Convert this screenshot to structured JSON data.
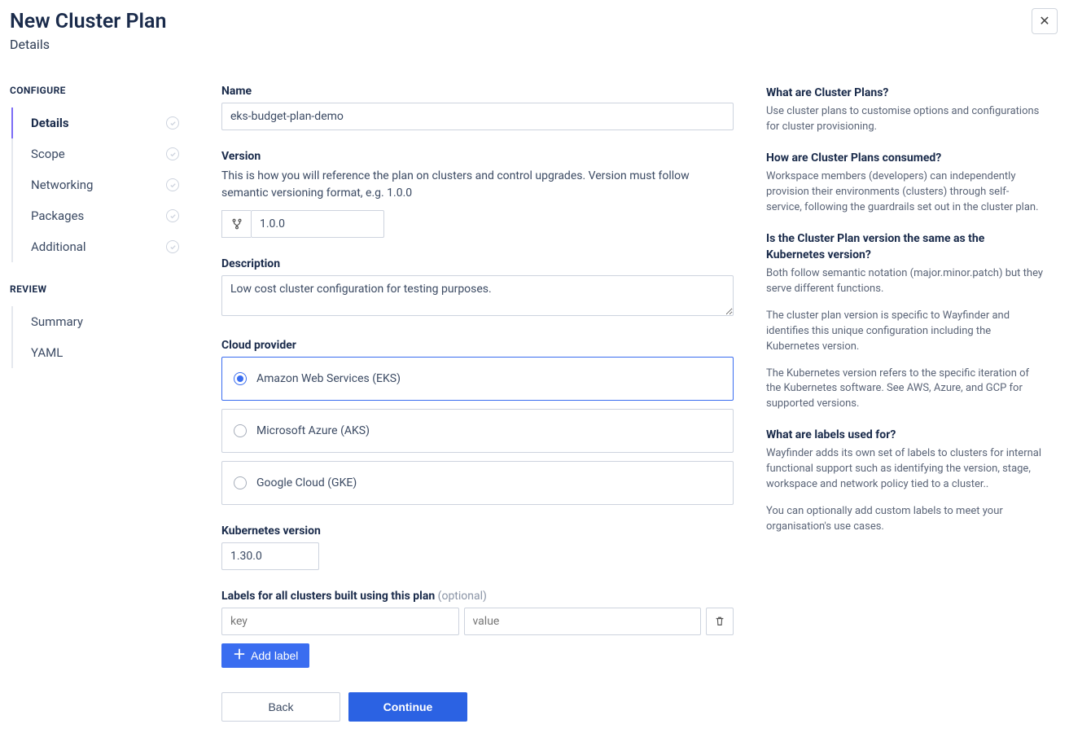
{
  "header": {
    "title": "New Cluster Plan",
    "subtitle": "Details"
  },
  "sidebar": {
    "configure_label": "CONFIGURE",
    "review_label": "REVIEW",
    "configure_items": [
      {
        "label": "Details"
      },
      {
        "label": "Scope"
      },
      {
        "label": "Networking"
      },
      {
        "label": "Packages"
      },
      {
        "label": "Additional"
      }
    ],
    "review_items": [
      {
        "label": "Summary"
      },
      {
        "label": "YAML"
      }
    ]
  },
  "form": {
    "name_label": "Name",
    "name_value": "eks-budget-plan-demo",
    "version_label": "Version",
    "version_hint": "This is how you will reference the plan on clusters and control upgrades. Version must follow semantic versioning format, e.g. 1.0.0",
    "version_value": "1.0.0",
    "description_label": "Description",
    "description_value": "Low cost cluster configuration for testing purposes.",
    "cloud_label": "Cloud provider",
    "cloud_options": [
      {
        "label": "Amazon Web Services (EKS)",
        "selected": true
      },
      {
        "label": "Microsoft Azure (AKS)",
        "selected": false
      },
      {
        "label": "Google Cloud (GKE)",
        "selected": false
      }
    ],
    "k8s_label": "Kubernetes version",
    "k8s_value": "1.30.0",
    "labels_label": "Labels for all clusters built using this plan ",
    "labels_optional": "(optional)",
    "label_key_placeholder": "key",
    "label_value_placeholder": "value",
    "add_label_btn": "Add label",
    "back_btn": "Back",
    "continue_btn": "Continue"
  },
  "info": {
    "q1": "What are Cluster Plans?",
    "a1": "Use cluster plans to customise options and configurations for cluster provisioning.",
    "q2": "How are Cluster Plans consumed?",
    "a2": "Workspace members (developers) can independently provision their environments (clusters) through self-service, following the guardrails set out in the cluster plan.",
    "q3": "Is the Cluster Plan version the same as the Kubernetes version?",
    "a3a": "Both follow semantic notation (major.minor.patch) but they serve different functions.",
    "a3b": "The cluster plan version is specific to Wayfinder and identifies this unique configuration including the Kubernetes version.",
    "a3c": "The Kubernetes version refers to the specific iteration of the Kubernetes software. See AWS, Azure, and GCP for supported versions.",
    "q4": "What are labels used for?",
    "a4a": "Wayfinder adds its own set of labels to clusters for internal functional support such as identifying the version, stage, workspace and network policy tied to a cluster..",
    "a4b": "You can optionally add custom labels to meet your organisation's use cases."
  }
}
